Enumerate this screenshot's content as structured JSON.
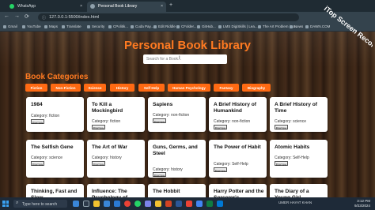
{
  "browser": {
    "tabs": [
      {
        "label": "WhatsApp",
        "fav_color": "#25d366"
      },
      {
        "label": "Personal Book Library",
        "fav_color": "#8fa0ab"
      }
    ],
    "new_tab_symbol": "+",
    "close_symbol": "×",
    "back": "←",
    "forward": "→",
    "reload": "⟳",
    "url": "127.0.0.1:5500/index.html",
    "bookmarks": [
      "Gmail",
      "YouTube",
      "Maps",
      "Translate",
      "Security",
      "CPolitik...",
      "Cuda Pay...",
      "Edit Riddle",
      "CFolder...",
      "GitHub...",
      "LMS DigiSkills | Lea...",
      "The Art Problem is a...",
      "News",
      "DAWN.COM"
    ]
  },
  "page": {
    "title": "Personal Book Library",
    "search_placeholder": "Search for a Book...",
    "categories_heading": "Book Categories",
    "categories": [
      "Fiction",
      "Non-Fiction",
      "Science",
      "History",
      "Self Help",
      "Human Psychology",
      "Fantasy",
      "Biography"
    ],
    "borrow_label": "Borrow",
    "books": [
      {
        "title": "1984",
        "category": "Category: fiction"
      },
      {
        "title": "To Kill a Mockingbird",
        "category": "Category: fiction"
      },
      {
        "title": "Sapiens",
        "category": "Category: non-fiction"
      },
      {
        "title": "A Brief History of Humankind",
        "category": "Category: non-fiction"
      },
      {
        "title": "A Brief History of Time",
        "category": "Category: science"
      },
      {
        "title": "The Selfish Gene",
        "category": "Category: science"
      },
      {
        "title": "The Art of War",
        "category": "Category: history"
      },
      {
        "title": "Guns, Germs, and Steel",
        "category": "Category: history"
      },
      {
        "title": "The Power of Habit",
        "category": "Category: Self-Help"
      },
      {
        "title": "Atomic Habits",
        "category": "Category: Self-Help"
      },
      {
        "title": "Thinking, Fast and Slow",
        "category": ""
      },
      {
        "title": "Influence: The Psychology of",
        "category": ""
      },
      {
        "title": "The Hobbit",
        "category": ""
      },
      {
        "title": "Harry Potter and the Sorcerer's",
        "category": ""
      },
      {
        "title": "The Diary of a Young Girl",
        "category": ""
      }
    ]
  },
  "taskbar": {
    "search_placeholder": "Type here to search",
    "tray_user": "UMER HAYAT KHAN",
    "time": "3:12 PM",
    "date": "9/23/2024"
  },
  "watermark": {
    "text": "iTop Screen Recorder"
  },
  "colors": {
    "accent": "#ff7a21",
    "button": "#ff6a13",
    "chrome": "#34434d"
  }
}
